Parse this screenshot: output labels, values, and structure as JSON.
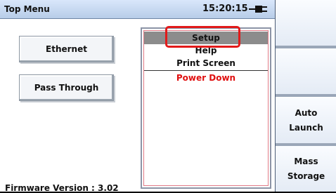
{
  "titlebar": {
    "title": "Top Menu",
    "time": "15:20:15",
    "power_icon": "plug-icon"
  },
  "main": {
    "buttons": [
      {
        "label": "Ethernet"
      },
      {
        "label": "Pass Through"
      }
    ],
    "firmware": "Firmware Version :  3.02"
  },
  "menu": {
    "items": [
      {
        "label": "Setup",
        "selected": true
      },
      {
        "label": "Help"
      },
      {
        "label": "Print Screen"
      },
      {
        "label": "Power Down",
        "color": "#e01010"
      }
    ],
    "highlight_color": "#e21a1a"
  },
  "softkeys": [
    {
      "label": ""
    },
    {
      "label": ""
    },
    {
      "label": "Auto\nLaunch"
    },
    {
      "label": "Mass\nStorage"
    }
  ]
}
